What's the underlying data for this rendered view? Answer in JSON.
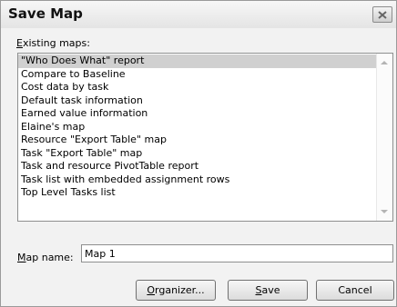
{
  "dialog": {
    "title": "Save Map",
    "close_icon": "close-icon"
  },
  "existing_maps": {
    "label_mnemonic": "E",
    "label_rest": "xisting maps:",
    "items": [
      "\"Who Does What\" report",
      "Compare to Baseline",
      "Cost data by task",
      "Default task information",
      "Earned value information",
      "Elaine's map",
      "Resource \"Export Table\" map",
      "Task \"Export Table\" map",
      "Task and resource PivotTable report",
      "Task list with embedded assignment rows",
      "Top Level Tasks list"
    ],
    "selected_index": 0
  },
  "map_name": {
    "label_mnemonic": "M",
    "label_rest": "ap name:",
    "value": "Map 1"
  },
  "buttons": {
    "organizer_mnemonic": "O",
    "organizer_rest": "rganizer...",
    "save_mnemonic": "S",
    "save_rest": "ave",
    "cancel": "Cancel"
  },
  "colors": {
    "selected_row": "#d0d0d0",
    "dialog_bg": "#f2f2f2"
  }
}
